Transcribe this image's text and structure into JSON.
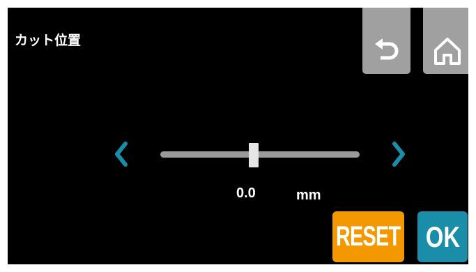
{
  "screen": {
    "title": "カット位置",
    "value": "0.0",
    "unit": "mm"
  },
  "buttons": {
    "reset_label": "RESET",
    "ok_label": "OK"
  },
  "slider": {
    "level_fraction": 0.47
  },
  "icons": {
    "back": "undo-arrow-icon",
    "home": "home-icon",
    "left": "chevron-left-icon",
    "right": "chevron-right-icon"
  },
  "colors": {
    "background": "#000000",
    "top_button": "#a0a0a0",
    "reset": "#f39800",
    "ok": "#1a8ea8",
    "arrow": "#1a8ea8",
    "track": "#9a9a9a",
    "thumb": "#e6e6e6"
  }
}
